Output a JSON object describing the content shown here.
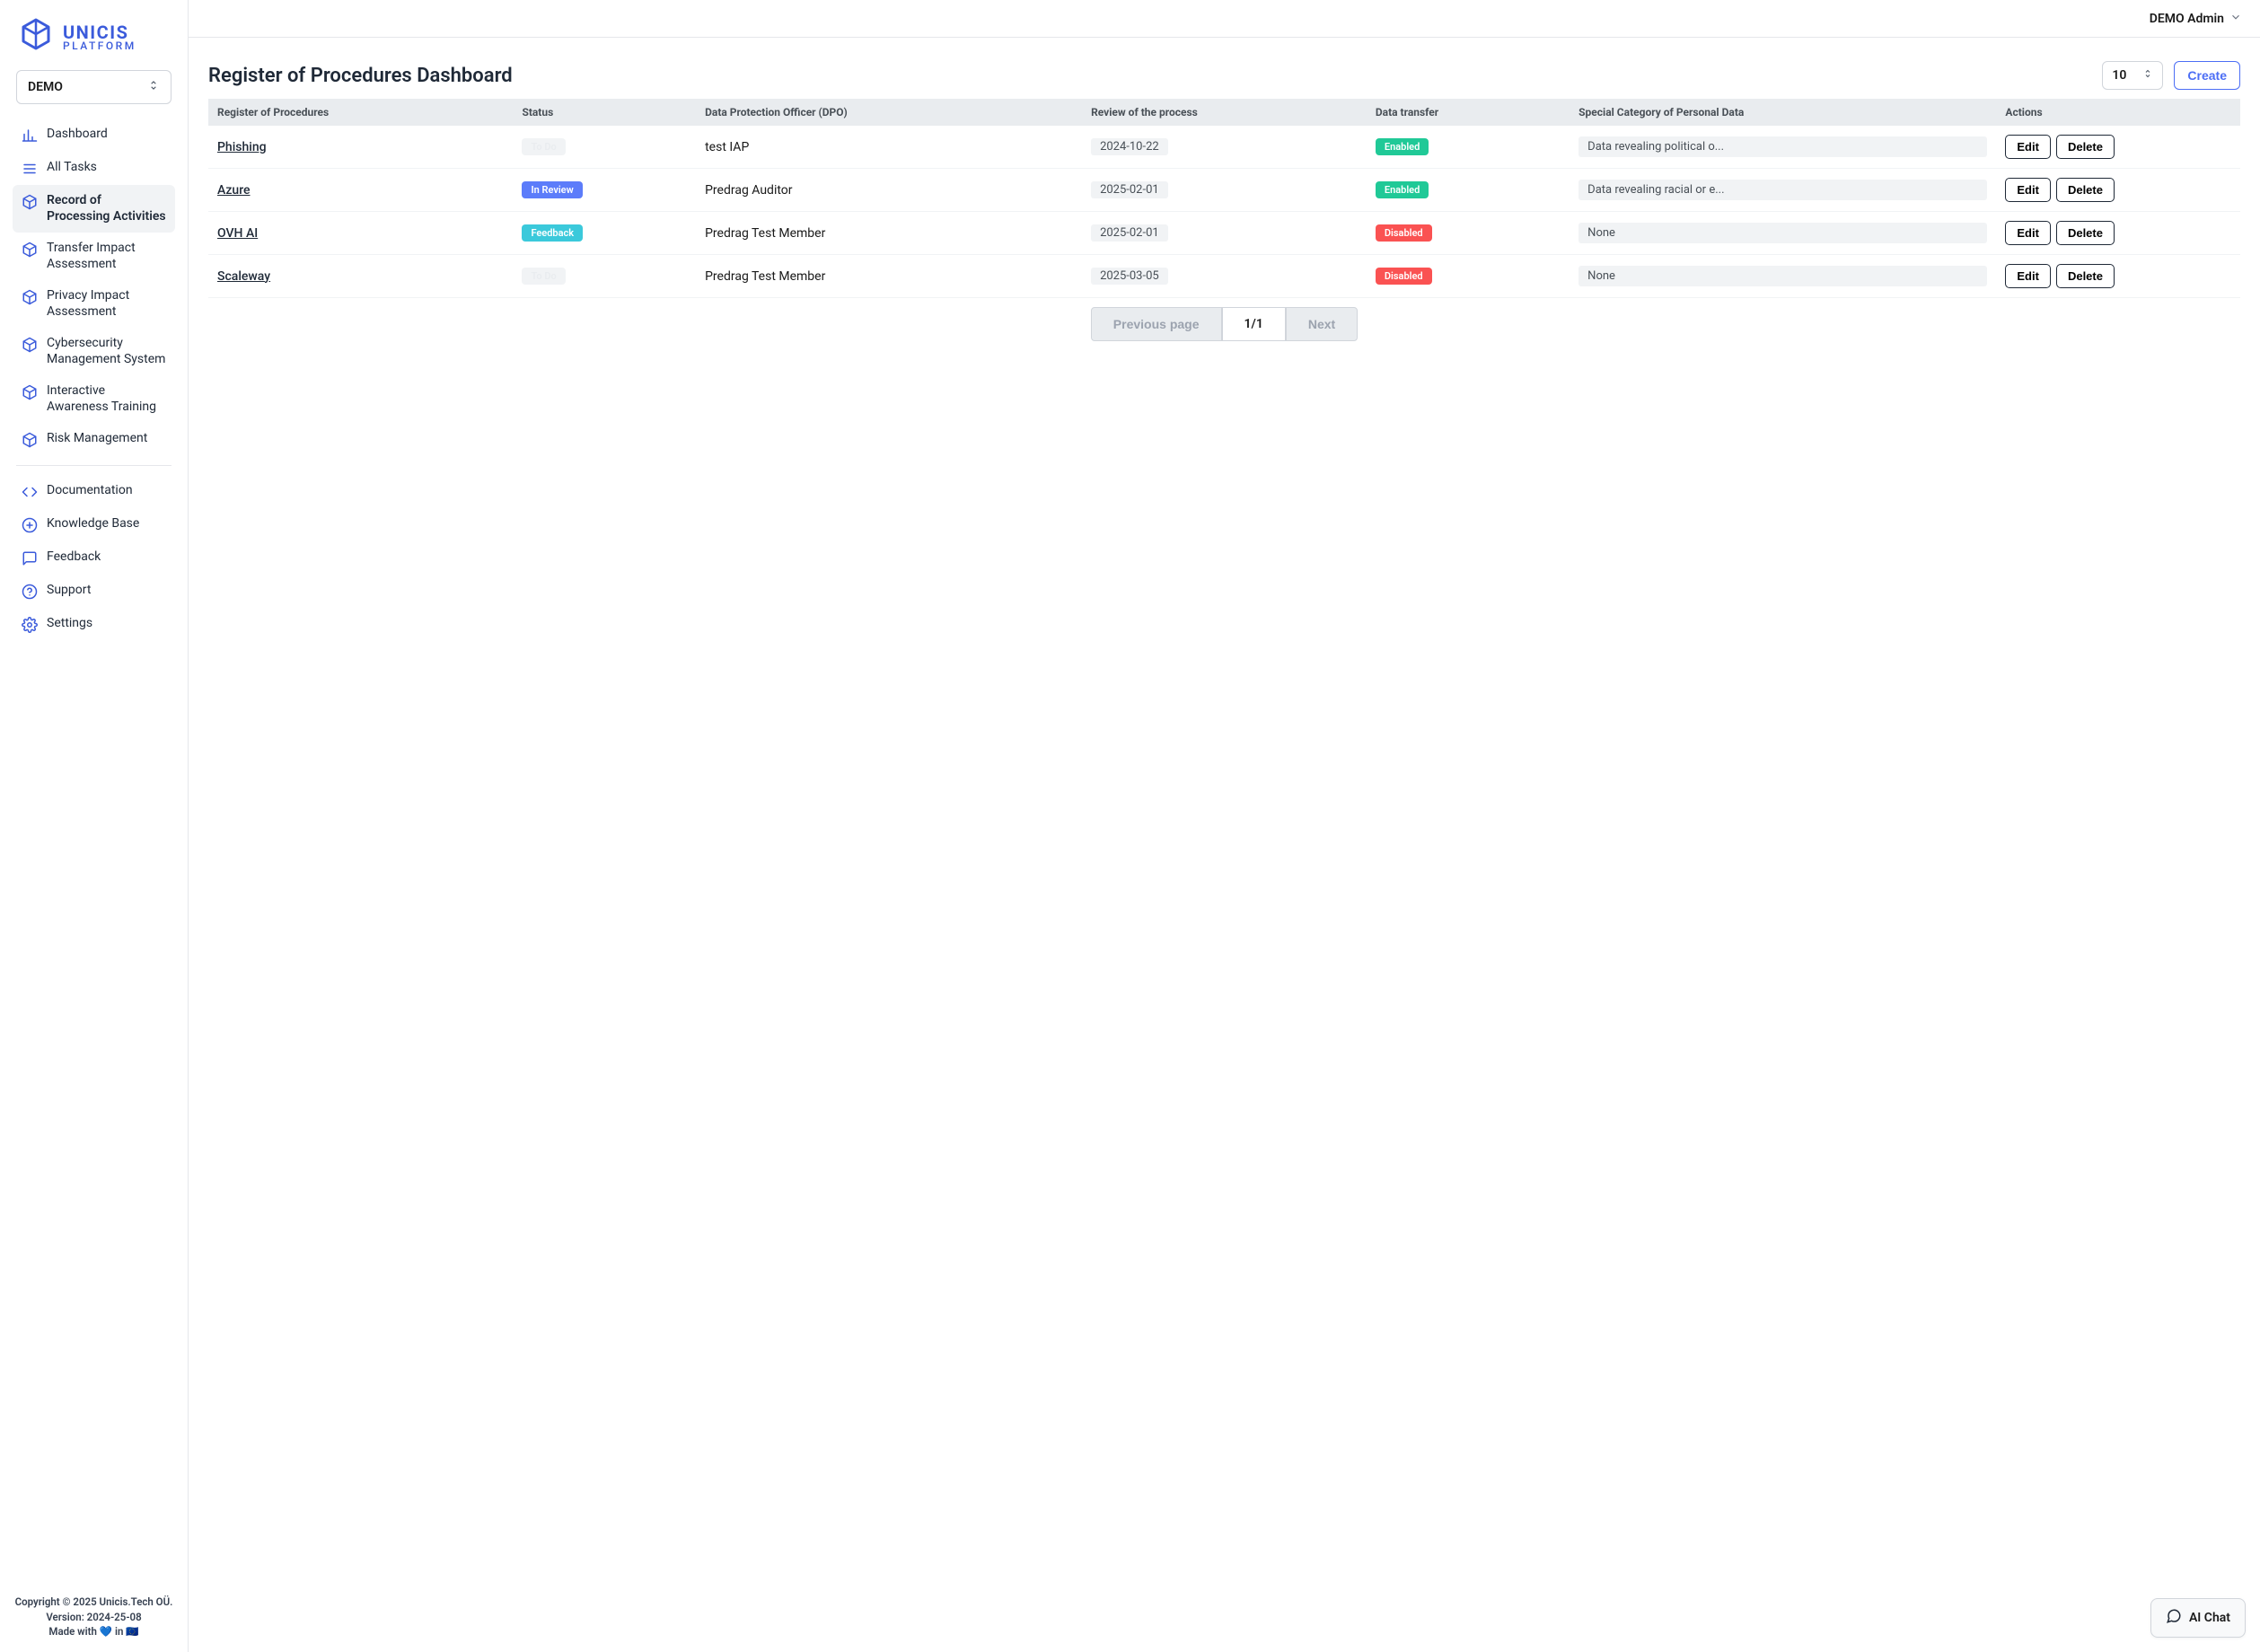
{
  "brand": {
    "name": "UNICIS",
    "subtitle": "PLATFORM"
  },
  "team_select": {
    "label": "DEMO"
  },
  "user_menu": {
    "label": "DEMO Admin"
  },
  "sidebar": {
    "items": [
      {
        "label": "Dashboard",
        "icon": "chart"
      },
      {
        "label": "All Tasks",
        "icon": "tasks"
      },
      {
        "label": "Record of Processing Activities",
        "icon": "cube",
        "active": true
      },
      {
        "label": "Transfer Impact Assessment",
        "icon": "cube"
      },
      {
        "label": "Privacy Impact Assessment",
        "icon": "cube"
      },
      {
        "label": "Cybersecurity Management System",
        "icon": "cube"
      },
      {
        "label": "Interactive Awareness Training",
        "icon": "cube"
      },
      {
        "label": "Risk Management",
        "icon": "cube"
      }
    ],
    "secondary": [
      {
        "label": "Documentation",
        "icon": "code"
      },
      {
        "label": "Knowledge Base",
        "icon": "kb"
      },
      {
        "label": "Feedback",
        "icon": "feedback"
      },
      {
        "label": "Support",
        "icon": "support"
      },
      {
        "label": "Settings",
        "icon": "settings"
      }
    ]
  },
  "footer": {
    "copyright": "Copyright © 2025 Unicis.Tech OÜ.",
    "version": "Version: 2024-25-08",
    "made_with_prefix": "Made with ",
    "made_with_suffix": " in "
  },
  "page": {
    "title": "Register of Procedures Dashboard",
    "page_size": "10",
    "create_label": "Create"
  },
  "table": {
    "headers": [
      "Register of Procedures",
      "Status",
      "Data Protection Officer (DPO)",
      "Review of the process",
      "Data transfer",
      "Special Category of Personal Data",
      "Actions"
    ],
    "rows": [
      {
        "name": "Phishing",
        "status": "To Do",
        "status_class": "todo",
        "dpo": "test IAP",
        "review": "2024-10-22",
        "transfer": "Enabled",
        "transfer_class": "enabled",
        "special": "Data revealing political o..."
      },
      {
        "name": "Azure",
        "status": "In Review",
        "status_class": "inreview",
        "dpo": "Predrag Auditor",
        "review": "2025-02-01",
        "transfer": "Enabled",
        "transfer_class": "enabled",
        "special": "Data revealing racial or e..."
      },
      {
        "name": "OVH AI",
        "status": "Feedback",
        "status_class": "feedback",
        "dpo": "Predrag Test Member",
        "review": "2025-02-01",
        "transfer": "Disabled",
        "transfer_class": "disabled",
        "special": "None"
      },
      {
        "name": "Scaleway",
        "status": "To Do",
        "status_class": "todo",
        "dpo": "Predrag Test Member",
        "review": "2025-03-05",
        "transfer": "Disabled",
        "transfer_class": "disabled",
        "special": "None"
      }
    ],
    "actions": {
      "edit": "Edit",
      "delete": "Delete"
    }
  },
  "pagination": {
    "prev": "Previous page",
    "current": "1/1",
    "next": "Next"
  },
  "ai_chat": {
    "label": "AI Chat"
  }
}
